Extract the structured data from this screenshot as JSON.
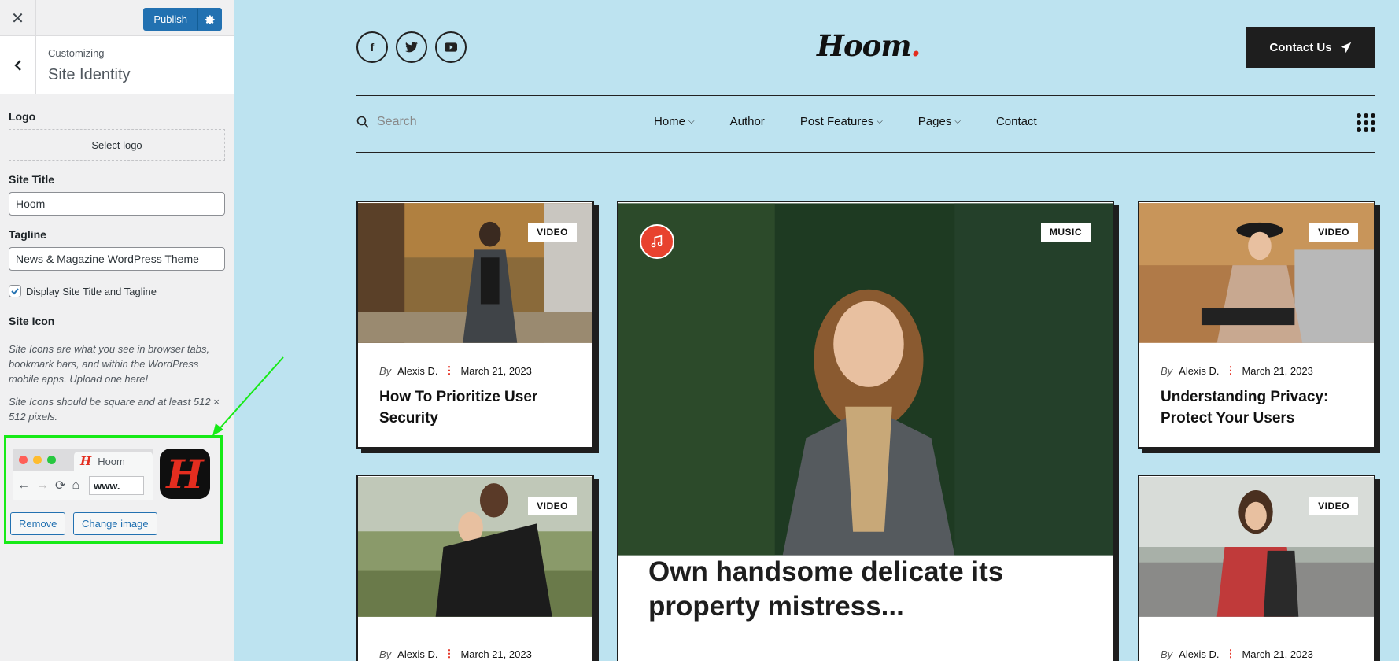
{
  "customizer": {
    "close_glyph": "✕",
    "publish_label": "Publish",
    "breadcrumb": "Customizing",
    "section_title": "Site Identity",
    "logo_label": "Logo",
    "select_logo_label": "Select logo",
    "site_title_label": "Site Title",
    "site_title_value": "Hoom",
    "tagline_label": "Tagline",
    "tagline_value": "News & Magazine WordPress Theme",
    "display_checkbox_label": "Display Site Title and Tagline",
    "display_checked": true,
    "site_icon_label": "Site Icon",
    "site_icon_desc1": "Site Icons are what you see in browser tabs, bookmark bars, and within the WordPress mobile apps. Upload one here!",
    "site_icon_desc2": "Site Icons should be square and at least 512 × 512 pixels.",
    "browser_tab_title": "Hoom",
    "browser_url": "www.",
    "icon_letter": "H",
    "remove_label": "Remove",
    "change_image_label": "Change image",
    "highlight_color": "#17ea17"
  },
  "site": {
    "social": [
      "f",
      "t",
      "yt"
    ],
    "logo_text": "Hoom",
    "logo_dot": ".",
    "contact_label": "Contact Us",
    "search_placeholder": "Search",
    "menu": [
      "Home",
      "Author",
      "Post Features",
      "Pages",
      "Contact"
    ],
    "menu_has_dropdown": [
      true,
      false,
      true,
      true,
      false
    ],
    "accent_color": "#e32d1f",
    "background_color": "#bde3f0"
  },
  "posts": [
    {
      "badge": "VIDEO",
      "by": "By",
      "author": "Alexis D.",
      "date": "March 21, 2023",
      "title": "How To Prioritize User Security"
    },
    {
      "badge": "MUSIC",
      "title": "Own handsome delicate its property mistress..."
    },
    {
      "badge": "VIDEO",
      "by": "By",
      "author": "Alexis D.",
      "date": "March 21, 2023",
      "title": "Understanding Privacy: Protect Your Users"
    },
    {
      "badge": "VIDEO",
      "by": "By",
      "author": "Alexis D.",
      "date": "March 21, 2023"
    },
    {
      "badge": "VIDEO",
      "by": "By",
      "author": "Alexis D.",
      "date": "March 21, 2023"
    }
  ]
}
